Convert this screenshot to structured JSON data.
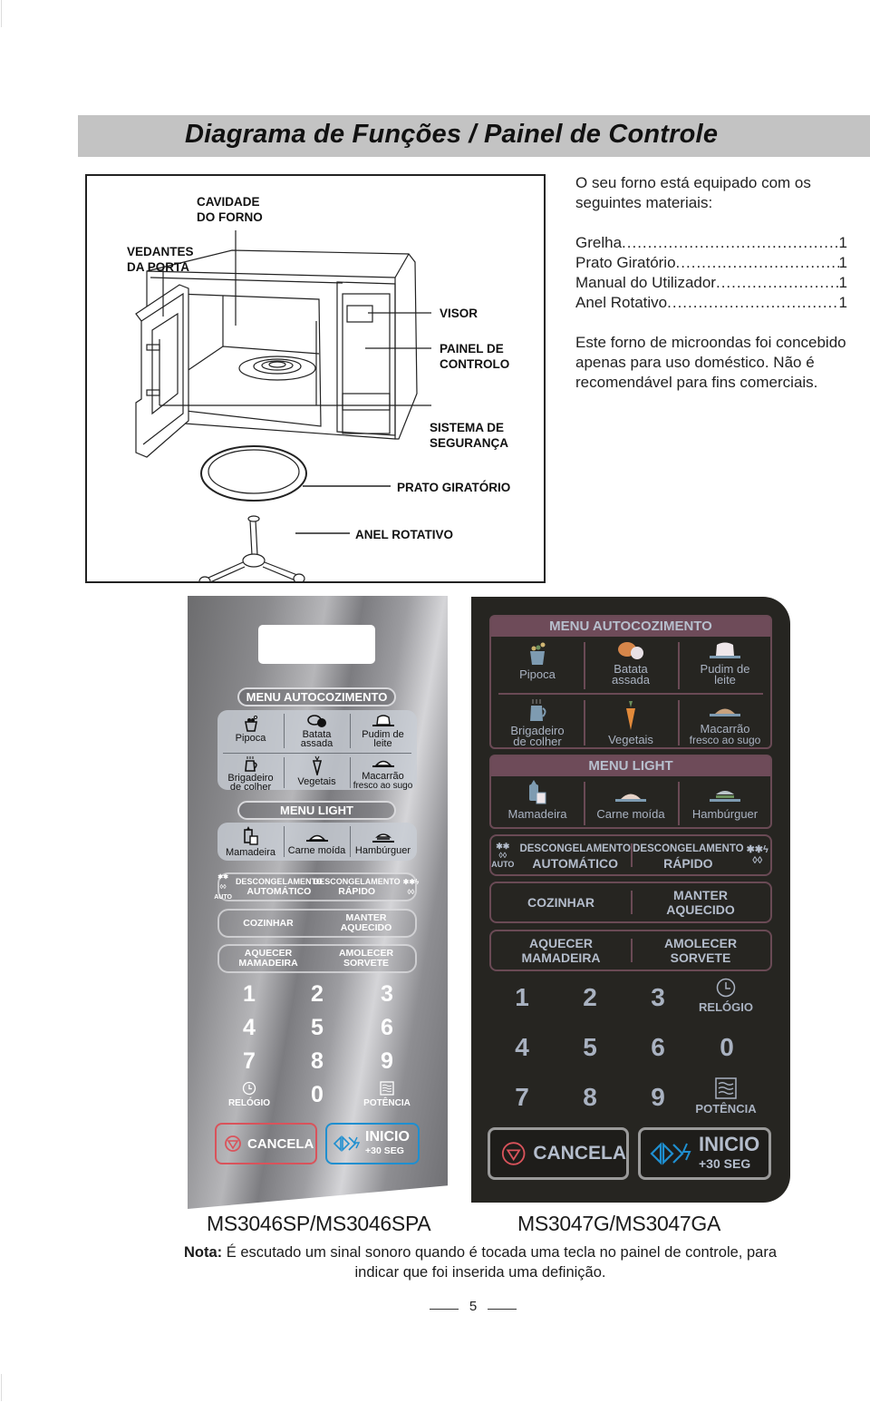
{
  "title": "Diagrama de Funções / Painel de Controle",
  "diagram": {
    "labels": {
      "oven_cavity": "CAVIDADE\nDO FORNO",
      "door_seals": "VEDANTES\nDA PORTA",
      "display": "VISOR",
      "control_panel": "PAINEL DE\nCONTROLO",
      "safety_system": "SISTEMA DE\nSEGURANÇA",
      "turntable": "PRATO GIRATÓRIO",
      "roller_ring": "ANEL ROTATIVO"
    }
  },
  "materials": {
    "intro": "O seu forno está equipado com os seguintes materiais:",
    "items": [
      {
        "name": "Grelha",
        "qty": "1"
      },
      {
        "name": "Prato Giratório",
        "qty": "1"
      },
      {
        "name": "Manual do Utilizador",
        "qty": "1"
      },
      {
        "name": "Anel Rotativo",
        "qty": "1"
      }
    ],
    "disclaimer": "Este forno de microondas foi concebido apenas para uso doméstico. Não é recomendável para fins comerciais."
  },
  "panels": {
    "menu_auto_title": "MENU AUTOCOZIMENTO",
    "menu_light_title": "MENU LIGHT",
    "auto_items": [
      {
        "l1": "Pipoca",
        "l2": ""
      },
      {
        "l1": "Batata",
        "l2": "assada"
      },
      {
        "l1": "Pudim de",
        "l2": "leite"
      },
      {
        "l1": "Brigadeiro",
        "l2": "de colher"
      },
      {
        "l1": "Vegetais",
        "l2": ""
      },
      {
        "l1": "Macarrão",
        "l2": "fresco ao sugo"
      }
    ],
    "light_items": [
      "Mamadeira",
      "Carne moída",
      "Hambúrguer"
    ],
    "defrost_auto": {
      "l1": "DESCONGELAMENTO",
      "l2": "AUTOMÁTICO",
      "badge": "AUTO"
    },
    "defrost_fast": {
      "l1": "DESCONGELAMENTO",
      "l2": "RÁPIDO"
    },
    "cook": "COZINHAR",
    "keep_warm": {
      "l1": "MANTER",
      "l2": "AQUECIDO"
    },
    "warm_bottle": {
      "l1": "AQUECER",
      "l2": "MAMADEIRA"
    },
    "soften_icecream": {
      "l1": "AMOLECER",
      "l2": "SORVETE"
    },
    "digits": [
      "1",
      "2",
      "3",
      "4",
      "5",
      "6",
      "7",
      "8",
      "9",
      "0"
    ],
    "clock": "RELÓGIO",
    "power": "POTÊNCIA",
    "cancel": "CANCELA",
    "start": "INICIO",
    "start_sub": "+30 SEG",
    "colors": {
      "cancel": "#d9535b",
      "start": "#1f8fd0",
      "dark_accent": "#6e4b59"
    }
  },
  "models": {
    "silver": "MS3046SP/MS3046SPA",
    "dark": "MS3047G/MS3047GA"
  },
  "note": {
    "label": "Nota:",
    "text": " É escutado um sinal sonoro quando é tocada uma tecla no painel de controle, para indicar que foi inserida uma definição."
  },
  "page_number": "5"
}
